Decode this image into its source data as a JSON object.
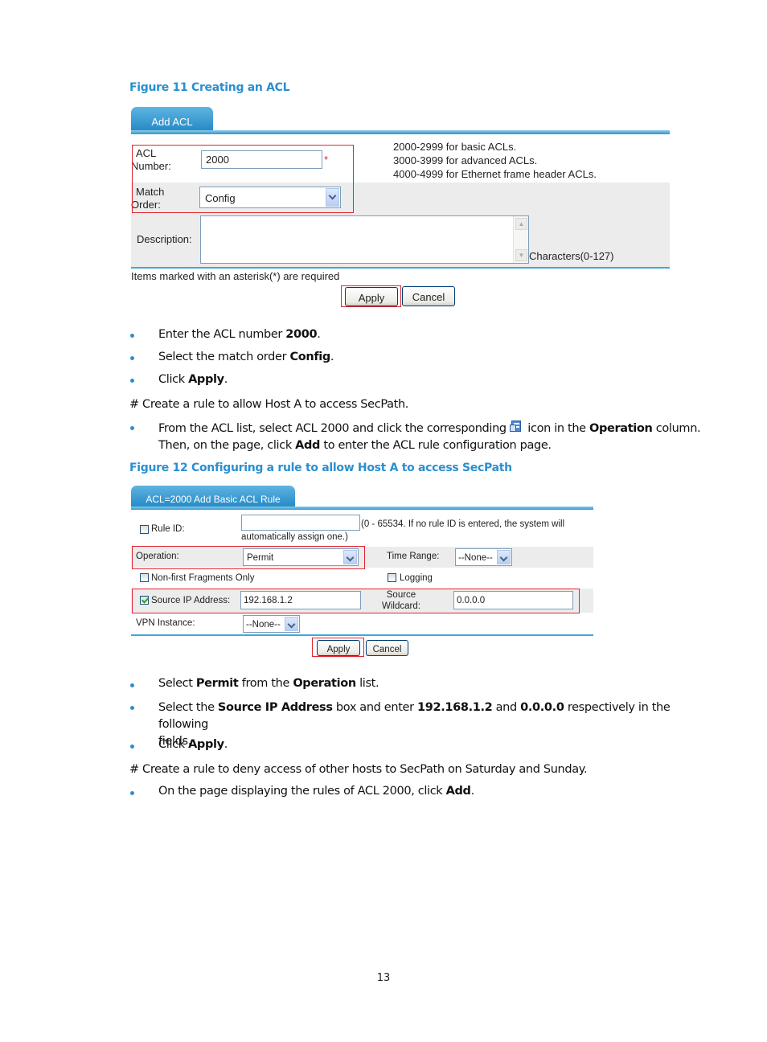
{
  "figure11": {
    "caption": "Figure 11 Creating an ACL",
    "tab_label": "Add ACL",
    "acl_number_label_1": "ACL",
    "acl_number_label_2": "Number:",
    "acl_number_value": "2000",
    "required_mark": "*",
    "hints": [
      "2000-2999 for basic ACLs.",
      "3000-3999 for advanced ACLs.",
      "4000-4999 for Ethernet frame header ACLs."
    ],
    "match_order_label_1": "Match",
    "match_order_label_2": "Order:",
    "match_order_value": "Config",
    "description_label": "Description:",
    "description_value": "",
    "characters_hint": "Characters(0-127)",
    "required_note": "Items marked with an asterisk(*) are required",
    "apply_label": "Apply",
    "cancel_label": "Cancel"
  },
  "steps1": [
    {
      "pre": "Enter the ACL number ",
      "bold": "2000",
      "post": "."
    },
    {
      "pre": "Select the match order ",
      "bold": "Config",
      "post": "."
    },
    {
      "pre": "Click ",
      "bold": "Apply",
      "post": "."
    }
  ],
  "comment1": "# Create a rule to allow Host A to access SecPath.",
  "step2": {
    "line1_pre": "From the ACL list, select ACL 2000 and click the corresponding ",
    "icon": "rule-list-icon",
    "line1_mid": " icon in the ",
    "line1_bold": "Operation",
    "line1_post": " column.",
    "line2_pre": "Then, on the page, click ",
    "line2_bold": "Add",
    "line2_post": " to enter the ACL rule configuration page."
  },
  "figure12": {
    "caption": "Figure 12 Configuring a rule to allow Host A to access SecPath",
    "tab_label": "ACL=2000 Add Basic ACL Rule",
    "rule_id_label": "Rule ID:",
    "rule_id_checked": false,
    "rule_id_value": "",
    "rule_id_hint_1": "(0 - 65534. If no rule ID is entered, the system will",
    "rule_id_hint_2": "automatically assign one.)",
    "operation_label": "Operation:",
    "operation_value": "Permit",
    "time_range_label": "Time Range:",
    "time_range_value": "--None--",
    "non_first_label": "Non-first Fragments Only",
    "non_first_checked": false,
    "logging_label": "Logging",
    "logging_checked": false,
    "source_ip_label": "Source IP Address:",
    "source_ip_checked": true,
    "source_ip_value": "192.168.1.2",
    "source_wildcard_label_1": "Source",
    "source_wildcard_label_2": "Wildcard:",
    "source_wildcard_value": "0.0.0.0",
    "vpn_label": "VPN Instance:",
    "vpn_value": "--None--",
    "apply_label": "Apply",
    "cancel_label": "Cancel"
  },
  "steps3": [
    {
      "pre": "Select ",
      "bold": "Permit",
      "mid": " from the ",
      "bold2": "Operation",
      "post": " list."
    },
    {
      "pre": "Select the ",
      "bold": "Source IP Address",
      "mid": " box and enter ",
      "bold2": "192.168.1.2",
      "mid2": " and ",
      "bold3": "0.0.0.0",
      "post": " respectively in the following",
      "line2": "fields."
    },
    {
      "pre": "Click ",
      "bold": "Apply",
      "post": "."
    }
  ],
  "comment2": "# Create a rule to deny access of other hosts to SecPath on Saturday and Sunday.",
  "step4": {
    "pre": "On the page displaying the rules of ACL 2000, click ",
    "bold": "Add",
    "post": "."
  },
  "page_number": "13",
  "colors": {
    "accent": "#2a8fd0",
    "highlight_red": "#e0262f",
    "tab_blue": "#1f86c4"
  }
}
